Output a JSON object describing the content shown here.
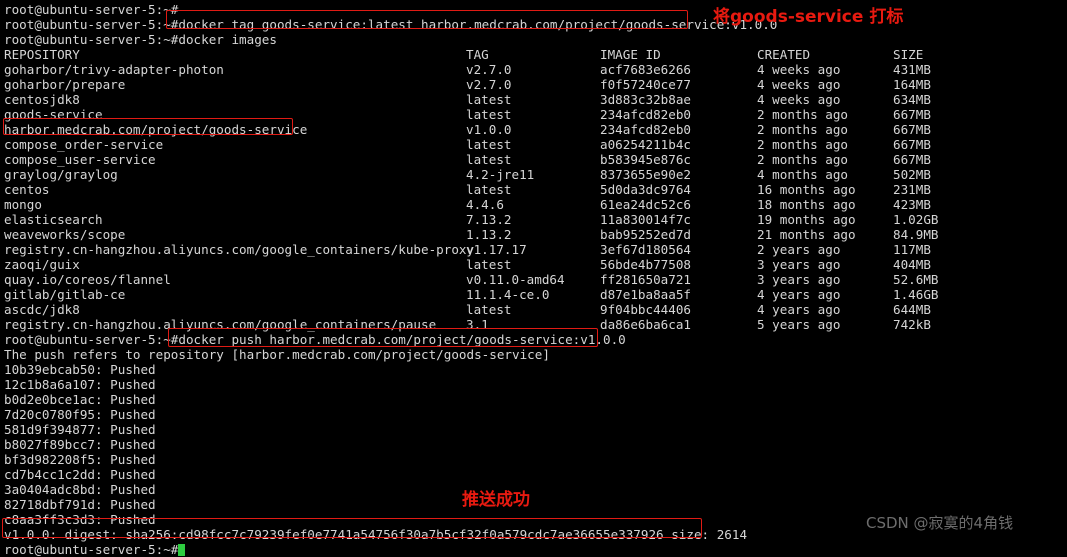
{
  "terminal": {
    "prompt": "root@ubuntu-server-5:~#",
    "colors": {
      "background": "#000000",
      "foreground": "#d6d6d6",
      "annotation_red": "#e81a10",
      "box_red": "#e01b14",
      "cursor_green": "#2ecc40",
      "watermark_gray": "#6d6d6d"
    },
    "lines_before_table": [
      {
        "type": "prompt_only",
        "text": ""
      },
      {
        "type": "command",
        "text": "docker tag goods-service:latest harbor.medcrab.com/project/goods-service:v1.0.0"
      },
      {
        "type": "command",
        "text": "docker images"
      }
    ],
    "table": {
      "headers": [
        "REPOSITORY",
        "TAG",
        "IMAGE ID",
        "CREATED",
        "SIZE"
      ],
      "rows": [
        [
          "goharbor/trivy-adapter-photon",
          "v2.7.0",
          "acf7683e6266",
          "4 weeks ago",
          "431MB"
        ],
        [
          "goharbor/prepare",
          "v2.7.0",
          "f0f57240ce77",
          "4 weeks ago",
          "164MB"
        ],
        [
          "centosjdk8",
          "latest",
          "3d883c32b8ae",
          "4 weeks ago",
          "634MB"
        ],
        [
          "goods-service",
          "latest",
          "234afcd82eb0",
          "2 months ago",
          "667MB"
        ],
        [
          "harbor.medcrab.com/project/goods-service",
          "v1.0.0",
          "234afcd82eb0",
          "2 months ago",
          "667MB"
        ],
        [
          "compose_order-service",
          "latest",
          "a06254211b4c",
          "2 months ago",
          "667MB"
        ],
        [
          "compose_user-service",
          "latest",
          "b583945e876c",
          "2 months ago",
          "667MB"
        ],
        [
          "graylog/graylog",
          "4.2-jre11",
          "8373655e90e2",
          "4 months ago",
          "502MB"
        ],
        [
          "centos",
          "latest",
          "5d0da3dc9764",
          "16 months ago",
          "231MB"
        ],
        [
          "mongo",
          "4.4.6",
          "61ea24dc52c6",
          "18 months ago",
          "423MB"
        ],
        [
          "elasticsearch",
          "7.13.2",
          "11a830014f7c",
          "19 months ago",
          "1.02GB"
        ],
        [
          "weaveworks/scope",
          "1.13.2",
          "bab95252ed7d",
          "21 months ago",
          "84.9MB"
        ],
        [
          "registry.cn-hangzhou.aliyuncs.com/google_containers/kube-proxy",
          "v1.17.17",
          "3ef67d180564",
          "2 years ago",
          "117MB"
        ],
        [
          "zaoqi/guix",
          "latest",
          "56bde4b77508",
          "3 years ago",
          "404MB"
        ],
        [
          "quay.io/coreos/flannel",
          "v0.11.0-amd64",
          "ff281650a721",
          "3 years ago",
          "52.6MB"
        ],
        [
          "gitlab/gitlab-ce",
          "11.1.4-ce.0",
          "d87e1ba8aa5f",
          "4 years ago",
          "1.46GB"
        ],
        [
          "ascdc/jdk8",
          "latest",
          "9f04bbc44406",
          "4 years ago",
          "644MB"
        ],
        [
          "registry.cn-hangzhou.aliyuncs.com/google_containers/pause",
          "3.1",
          "da86e6ba6ca1",
          "5 years ago",
          "742kB"
        ]
      ]
    },
    "push_command": "docker push harbor.medcrab.com/project/goods-service:v1.0.0",
    "push_refers": "The push refers to repository [harbor.medcrab.com/project/goods-service]",
    "push_layers": [
      "10b39ebcab50: Pushed",
      "12c1b8a6a107: Pushed",
      "b0d2e0bce1ac: Pushed",
      "7d20c0780f95: Pushed",
      "581d9f394877: Pushed",
      "b8027f89bcc7: Pushed",
      "bf3d982208f5: Pushed",
      "cd7b4cc1c2dd: Pushed",
      "3a0404adc8bd: Pushed",
      "82718dbf791d: Pushed",
      "c8aa3ff3c3d3: Pushed"
    ],
    "digest_line": "v1.0.0: digest: sha256:cd98fcc7c79239fef0e7741a54756f30a7b5cf32f0a579cdc7ae36655e337926 size: 2614",
    "final_prompt": "root@ubuntu-server-5:~#"
  },
  "annotations": {
    "tag_note": "将goods-service 打标",
    "push_note": "推送成功"
  },
  "watermark": {
    "text": "CSDN @寂寞的4角钱"
  }
}
